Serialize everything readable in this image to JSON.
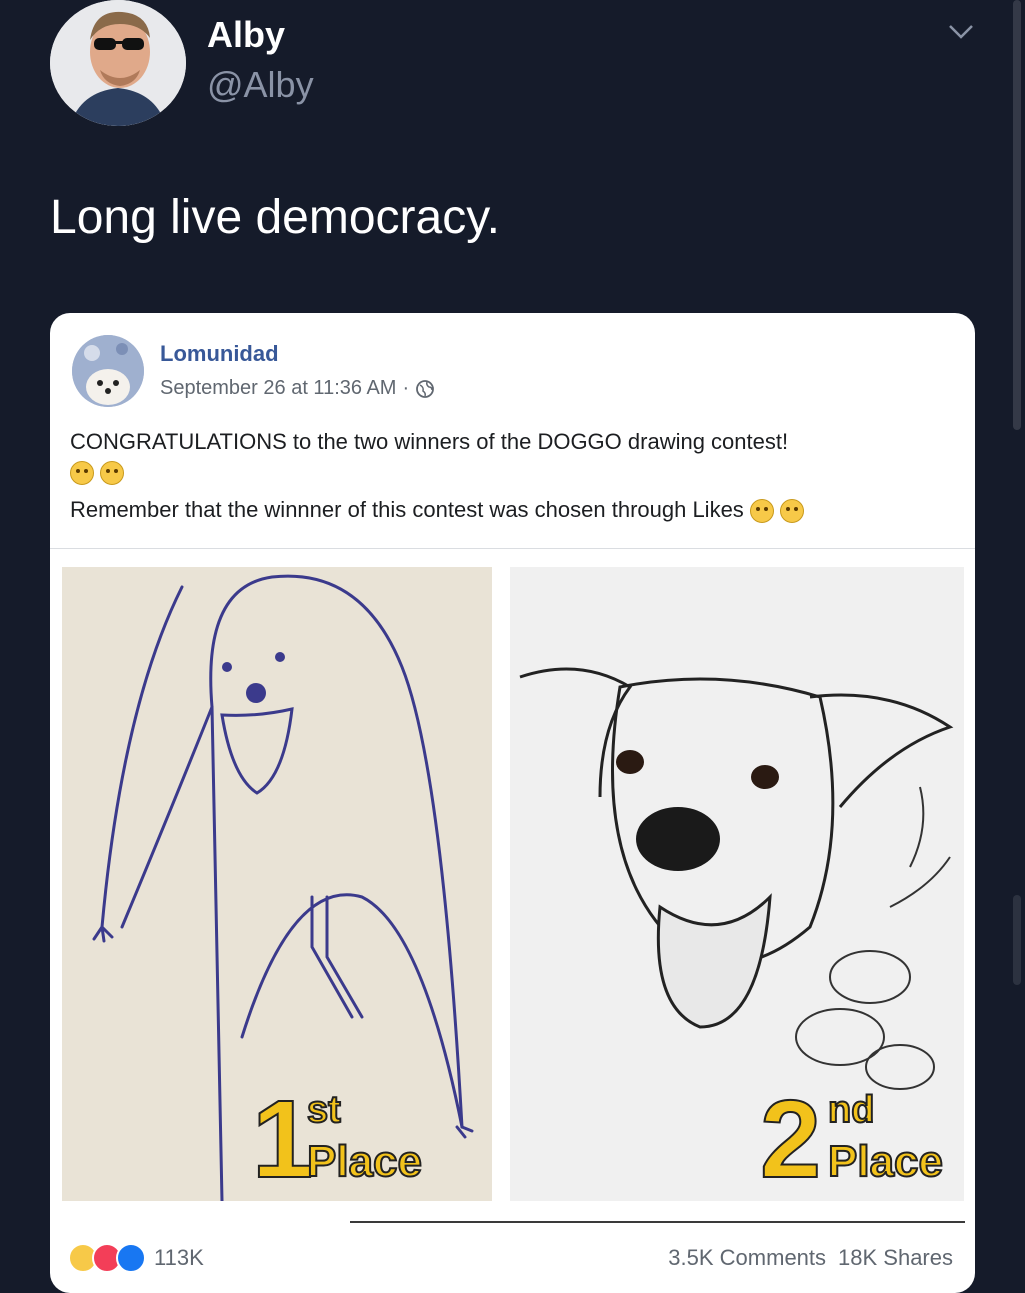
{
  "tweet": {
    "author_name": "Alby",
    "author_handle": "@Alby",
    "text": "Long live democracy."
  },
  "post": {
    "page_name": "Lomunidad",
    "timestamp": "September 26 at 11:36 AM",
    "separator": "·",
    "line1": "CONGRATULATIONS to the two winners of the DOGGO drawing contest!",
    "line2": "Remember that the winnner of this contest was chosen through Likes",
    "images": [
      {
        "number": "1",
        "ordinal": "st",
        "place": "Place"
      },
      {
        "number": "2",
        "ordinal": "nd",
        "place": "Place"
      }
    ],
    "reaction_count": "113K",
    "comments": "3.5K Comments",
    "shares": "18K Shares"
  },
  "icons": [
    "chevron-down-icon",
    "globe-icon",
    "haha-reaction-icon",
    "love-reaction-icon",
    "like-reaction-icon"
  ],
  "colors": {
    "background": "#151b2a",
    "link": "#385898",
    "medal_gold": "#f2c21b"
  }
}
